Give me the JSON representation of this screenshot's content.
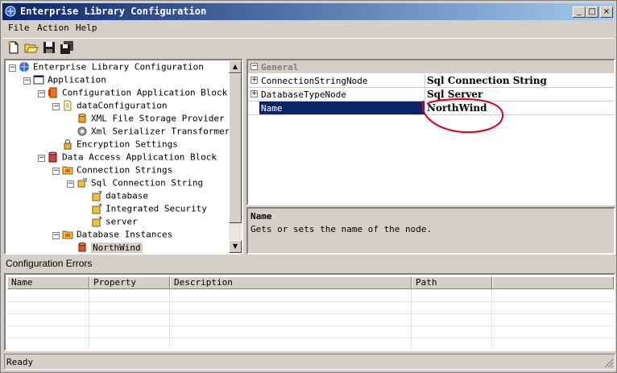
{
  "window": {
    "title": "Enterprise Library Configuration",
    "controls": {
      "minimize": "_",
      "maximize": "□",
      "close": "×"
    }
  },
  "menu": [
    {
      "label": "File"
    },
    {
      "label": "Action"
    },
    {
      "label": "Help"
    }
  ],
  "toolbar": [
    {
      "icon": "new-icon"
    },
    {
      "icon": "open-icon"
    },
    {
      "icon": "save-icon"
    },
    {
      "icon": "save-all-icon"
    }
  ],
  "tree": [
    {
      "label": "Enterprise Library Configuration",
      "icon": "globe-icon",
      "indent": 0,
      "expander": "-"
    },
    {
      "label": "Application",
      "icon": "window-icon",
      "indent": 1,
      "expander": "-"
    },
    {
      "label": "Configuration Application Block",
      "icon": "block-icon",
      "indent": 2,
      "expander": "-"
    },
    {
      "label": "dataConfiguration",
      "icon": "document-icon",
      "indent": 3,
      "expander": "-"
    },
    {
      "label": "XML File Storage Provider",
      "icon": "cylinder-icon",
      "indent": 4,
      "expander": ""
    },
    {
      "label": "Xml Serializer Transformer",
      "icon": "gear-icon",
      "indent": 4,
      "expander": ""
    },
    {
      "label": "Encryption Settings",
      "icon": "lock-icon",
      "indent": 3,
      "expander": ""
    },
    {
      "label": "Data Access Application Block",
      "icon": "database-block-icon",
      "indent": 2,
      "expander": "-"
    },
    {
      "label": "Connection Strings",
      "icon": "folder-icon",
      "indent": 3,
      "expander": "-"
    },
    {
      "label": "Sql Connection String",
      "icon": "connection-icon",
      "indent": 4,
      "expander": "-"
    },
    {
      "label": "database",
      "icon": "parameter-icon",
      "indent": 5,
      "expander": ""
    },
    {
      "label": "Integrated Security",
      "icon": "parameter-icon",
      "indent": 5,
      "expander": ""
    },
    {
      "label": "server",
      "icon": "parameter-icon",
      "indent": 5,
      "expander": ""
    },
    {
      "label": "Database Instances",
      "icon": "folder-icon",
      "indent": 3,
      "expander": "-"
    },
    {
      "label": "NorthWind",
      "icon": "instance-icon",
      "indent": 4,
      "expander": "",
      "selected": true
    }
  ],
  "properties": {
    "category": "General",
    "rows": [
      {
        "name": "ConnectionStringNode",
        "value": "Sql Connection String",
        "expander": "+"
      },
      {
        "name": "DatabaseTypeNode",
        "value": "Sql Server",
        "expander": "+"
      },
      {
        "name": "Name",
        "value": "NorthWind",
        "expander": "",
        "selected": true
      }
    ]
  },
  "description": {
    "title": "Name",
    "text": "Gets or sets the name of the node."
  },
  "errors": {
    "title": "Configuration Errors",
    "columns": [
      "Name",
      "Property",
      "Description",
      "Path"
    ]
  },
  "status": {
    "text": "Ready"
  },
  "colors": {
    "title_start": "#0a246a",
    "title_end": "#a6caf0",
    "selection": "#0a246a",
    "annotation": "#e0001b"
  }
}
